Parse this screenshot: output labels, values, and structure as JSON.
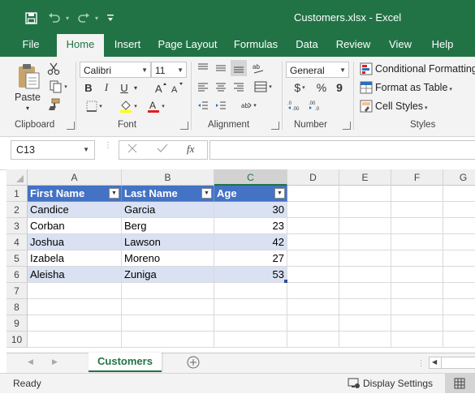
{
  "window": {
    "title": "Customers.xlsx  -  Excel",
    "accent": "#217346"
  },
  "qat": {
    "save_icon": "save-icon",
    "undo_icon": "undo-icon",
    "redo_icon": "redo-icon",
    "customize_icon": "customize-qat-icon"
  },
  "tabs": [
    "File",
    "Home",
    "Insert",
    "Page Layout",
    "Formulas",
    "Data",
    "Review",
    "View",
    "Help"
  ],
  "active_tab": "Home",
  "ribbon": {
    "clipboard": {
      "label": "Clipboard",
      "paste": "Paste"
    },
    "font": {
      "label": "Font",
      "name": "Calibri",
      "size": "11",
      "bold": "B",
      "italic": "I",
      "underline": "U"
    },
    "alignment": {
      "label": "Alignment"
    },
    "number": {
      "label": "Number",
      "format": "General",
      "currency": "$",
      "percent": "%",
      "comma": "9"
    },
    "styles": {
      "label": "Styles",
      "conditional": "Conditional Formatting",
      "format_table": "Format as Table",
      "cell_styles": "Cell Styles"
    }
  },
  "formula_bar": {
    "name_box": "C13",
    "fx": "fx",
    "value": ""
  },
  "columns": [
    "A",
    "B",
    "C",
    "D",
    "E",
    "F",
    "G"
  ],
  "rows": [
    "1",
    "2",
    "3",
    "4",
    "5",
    "6",
    "7",
    "8",
    "9",
    "10"
  ],
  "table": {
    "headers": [
      "First Name",
      "Last Name",
      "Age"
    ],
    "rows": [
      [
        "Candice",
        "Garcia",
        "30"
      ],
      [
        "Corban",
        "Berg",
        "23"
      ],
      [
        "Joshua",
        "Lawson",
        "42"
      ],
      [
        "Izabela",
        "Moreno",
        "27"
      ],
      [
        "Aleisha",
        "Zuniga",
        "53"
      ]
    ],
    "header_color": "#4472c4",
    "band_color": "#d9e1f2"
  },
  "sheets": [
    "Customers"
  ],
  "status": {
    "ready": "Ready",
    "display_settings": "Display Settings"
  }
}
